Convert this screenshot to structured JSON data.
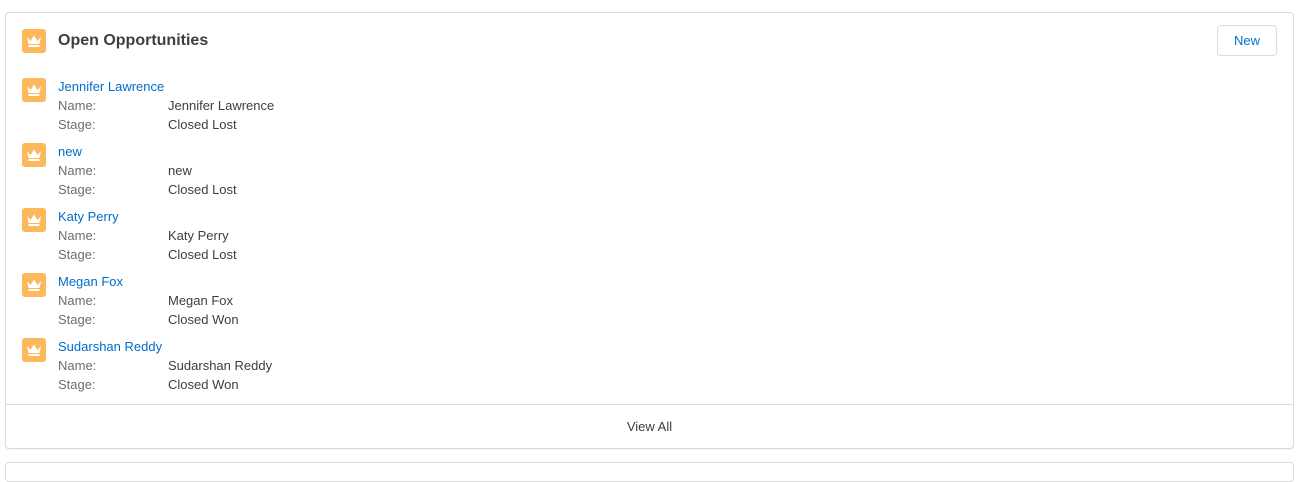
{
  "header": {
    "title": "Open Opportunities",
    "icon": "crown-icon",
    "new_label": "New"
  },
  "colors": {
    "icon_bg": "#fcb95b",
    "link": "#006dcc",
    "title": "#3e3e3c"
  },
  "records": [
    {
      "title": "Jennifer Lawrence",
      "name_label": "Name:",
      "name": "Jennifer Lawrence",
      "stage_label": "Stage:",
      "stage": "Closed Lost"
    },
    {
      "title": "new",
      "name_label": "Name:",
      "name": "new",
      "stage_label": "Stage:",
      "stage": "Closed Lost"
    },
    {
      "title": "Katy Perry",
      "name_label": "Name:",
      "name": "Katy Perry",
      "stage_label": "Stage:",
      "stage": "Closed Lost"
    },
    {
      "title": "Megan Fox",
      "name_label": "Name:",
      "name": "Megan Fox",
      "stage_label": "Stage:",
      "stage": "Closed Won"
    },
    {
      "title": "Sudarshan Reddy",
      "name_label": "Name:",
      "name": "Sudarshan Reddy",
      "stage_label": "Stage:",
      "stage": "Closed Won"
    }
  ],
  "footer": {
    "view_all_label": "View All"
  }
}
